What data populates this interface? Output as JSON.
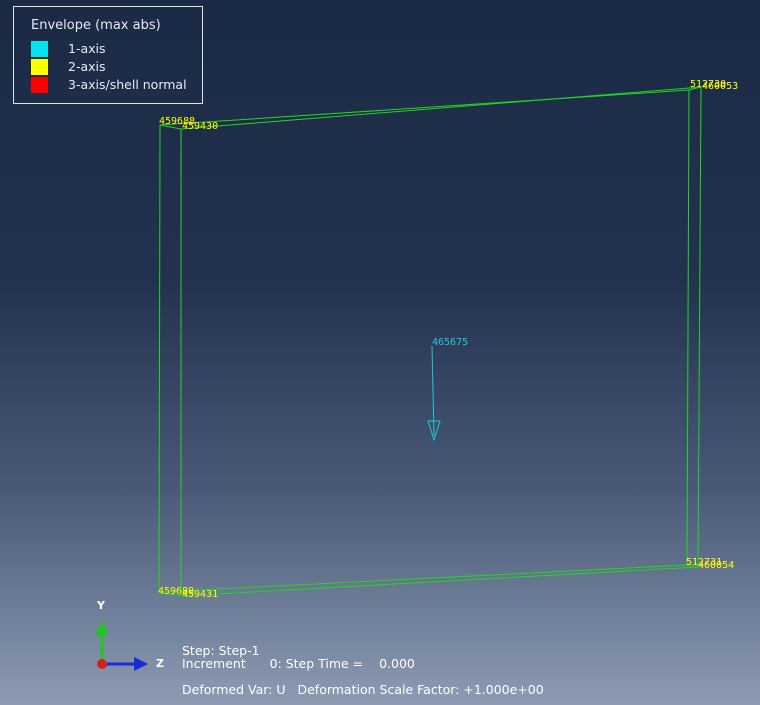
{
  "legend": {
    "title": "Envelope (max abs)",
    "items": [
      {
        "label": "1-axis",
        "color": "#00e5ee"
      },
      {
        "label": "2-axis",
        "color": "#ffff00"
      },
      {
        "label": "3-axis/shell normal",
        "color": "#ff0000"
      }
    ]
  },
  "viewport": {
    "frame_color": "#22d622",
    "node_label_color": "#ffff00",
    "arrow_color": "#20c8d8",
    "node_labels": {
      "top_left_outer": "459688",
      "top_left_inner": "459430",
      "top_right_outer": "512730",
      "top_right_inner": "460053",
      "bottom_left_outer": "459689",
      "bottom_left_inner": "459431",
      "bottom_right_outer": "512731",
      "bottom_right_inner": "460054"
    },
    "center_node_label": "465675"
  },
  "triad": {
    "y_label": "Y",
    "z_label": "Z"
  },
  "status": {
    "step": "Step: Step-1",
    "increment": "Increment      0: Step Time =    0.000",
    "deformed": "Deformed Var: U   Deformation Scale Factor: +1.000e+00"
  }
}
